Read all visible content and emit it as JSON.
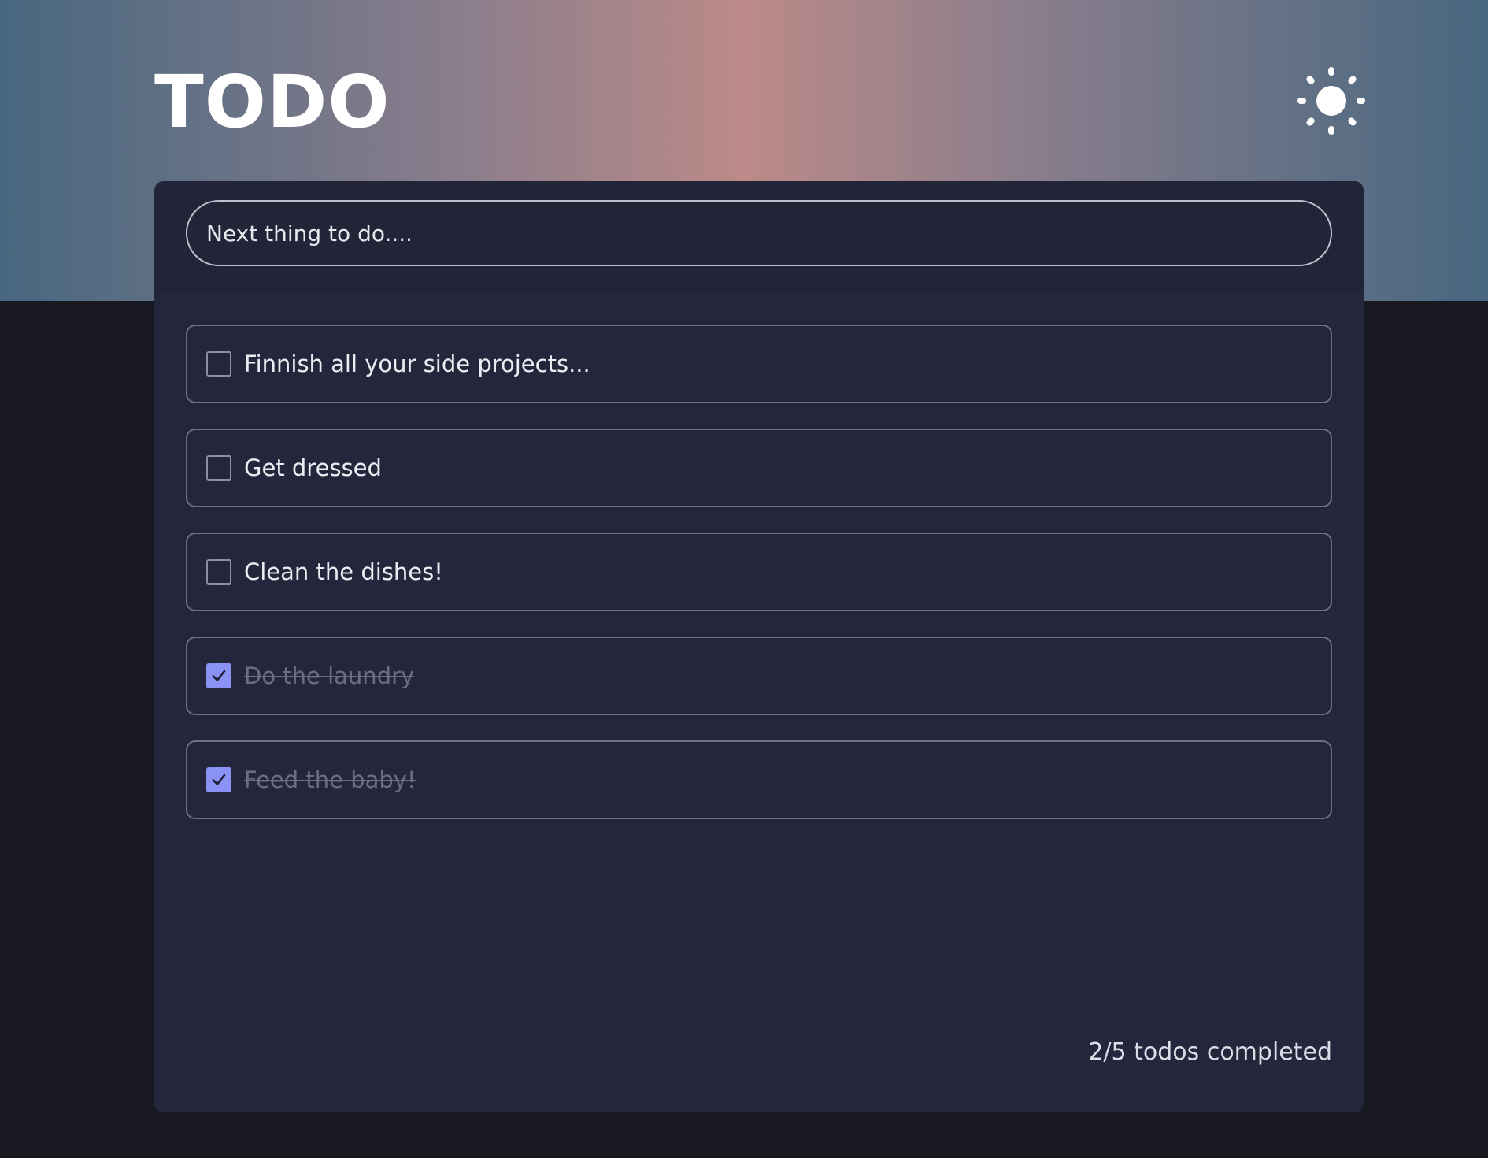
{
  "header": {
    "title": "TODO",
    "theme_icon": "sun-icon"
  },
  "input": {
    "placeholder": "Next thing to do....",
    "value": ""
  },
  "todos": [
    {
      "text": "Finnish all your side projects...",
      "completed": false
    },
    {
      "text": "Get dressed",
      "completed": false
    },
    {
      "text": "Clean the dishes!",
      "completed": false
    },
    {
      "text": "Do the laundry",
      "completed": true
    },
    {
      "text": "Feed the baby!",
      "completed": true
    }
  ],
  "footer": {
    "status": "2/5 todos completed"
  },
  "colors": {
    "accent": "#8a93f5",
    "card_bg": "#24273b",
    "page_bg": "#181821"
  }
}
